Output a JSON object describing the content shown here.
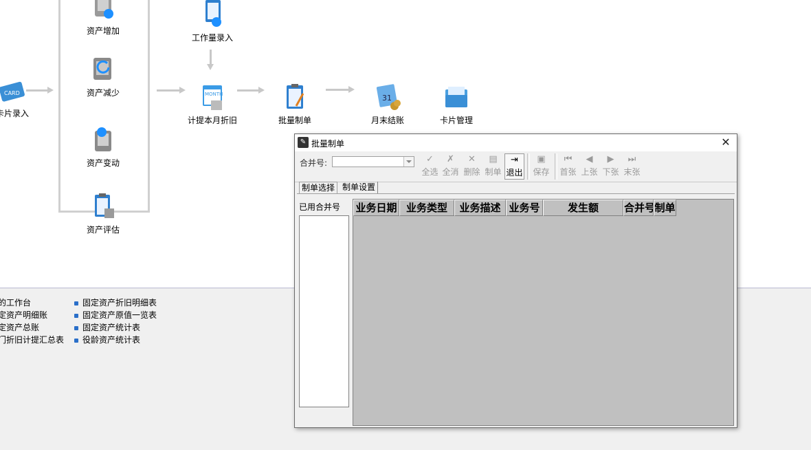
{
  "flow": {
    "nodes": {
      "card_entry": "卡片录入",
      "asset_add": "资产增加",
      "asset_reduce": "资产减少",
      "asset_change": "资产变动",
      "asset_evaluate": "资产评估",
      "workload_entry": "工作量录入",
      "depreciation": "计提本月折旧",
      "batch_voucher": "批量制单",
      "month_end": "月末结账",
      "card_manage": "卡片管理"
    }
  },
  "reports": {
    "col1": [
      "的工作台",
      "定资产明细账",
      "定资产总账",
      "门折旧计提汇总表"
    ],
    "col2": [
      "固定资产折旧明细表",
      "固定资产原值一览表",
      "固定资产统计表",
      "役龄资产统计表"
    ]
  },
  "dialog": {
    "title": "批量制单",
    "close": "✕",
    "merge_label": "合并号:",
    "merge_value": "",
    "toolbar": {
      "select_all": "全选",
      "deselect_all": "全消",
      "delete": "删除",
      "make_voucher": "制单",
      "exit": "退出",
      "save": "保存",
      "first": "首张",
      "prev": "上张",
      "next": "下张",
      "last": "末张"
    },
    "tabs": [
      "制单选择",
      "制单设置"
    ],
    "left_pane_label": "已用合并号",
    "grid_columns": [
      "业务日期",
      "业务类型",
      "业务描述",
      "业务号",
      "发生额",
      "合并号",
      "制单"
    ]
  },
  "colors": {
    "accent": "#2a6fc9",
    "grid_bg": "#c0c0c0",
    "dialog_bg": "#f0f0f0"
  }
}
